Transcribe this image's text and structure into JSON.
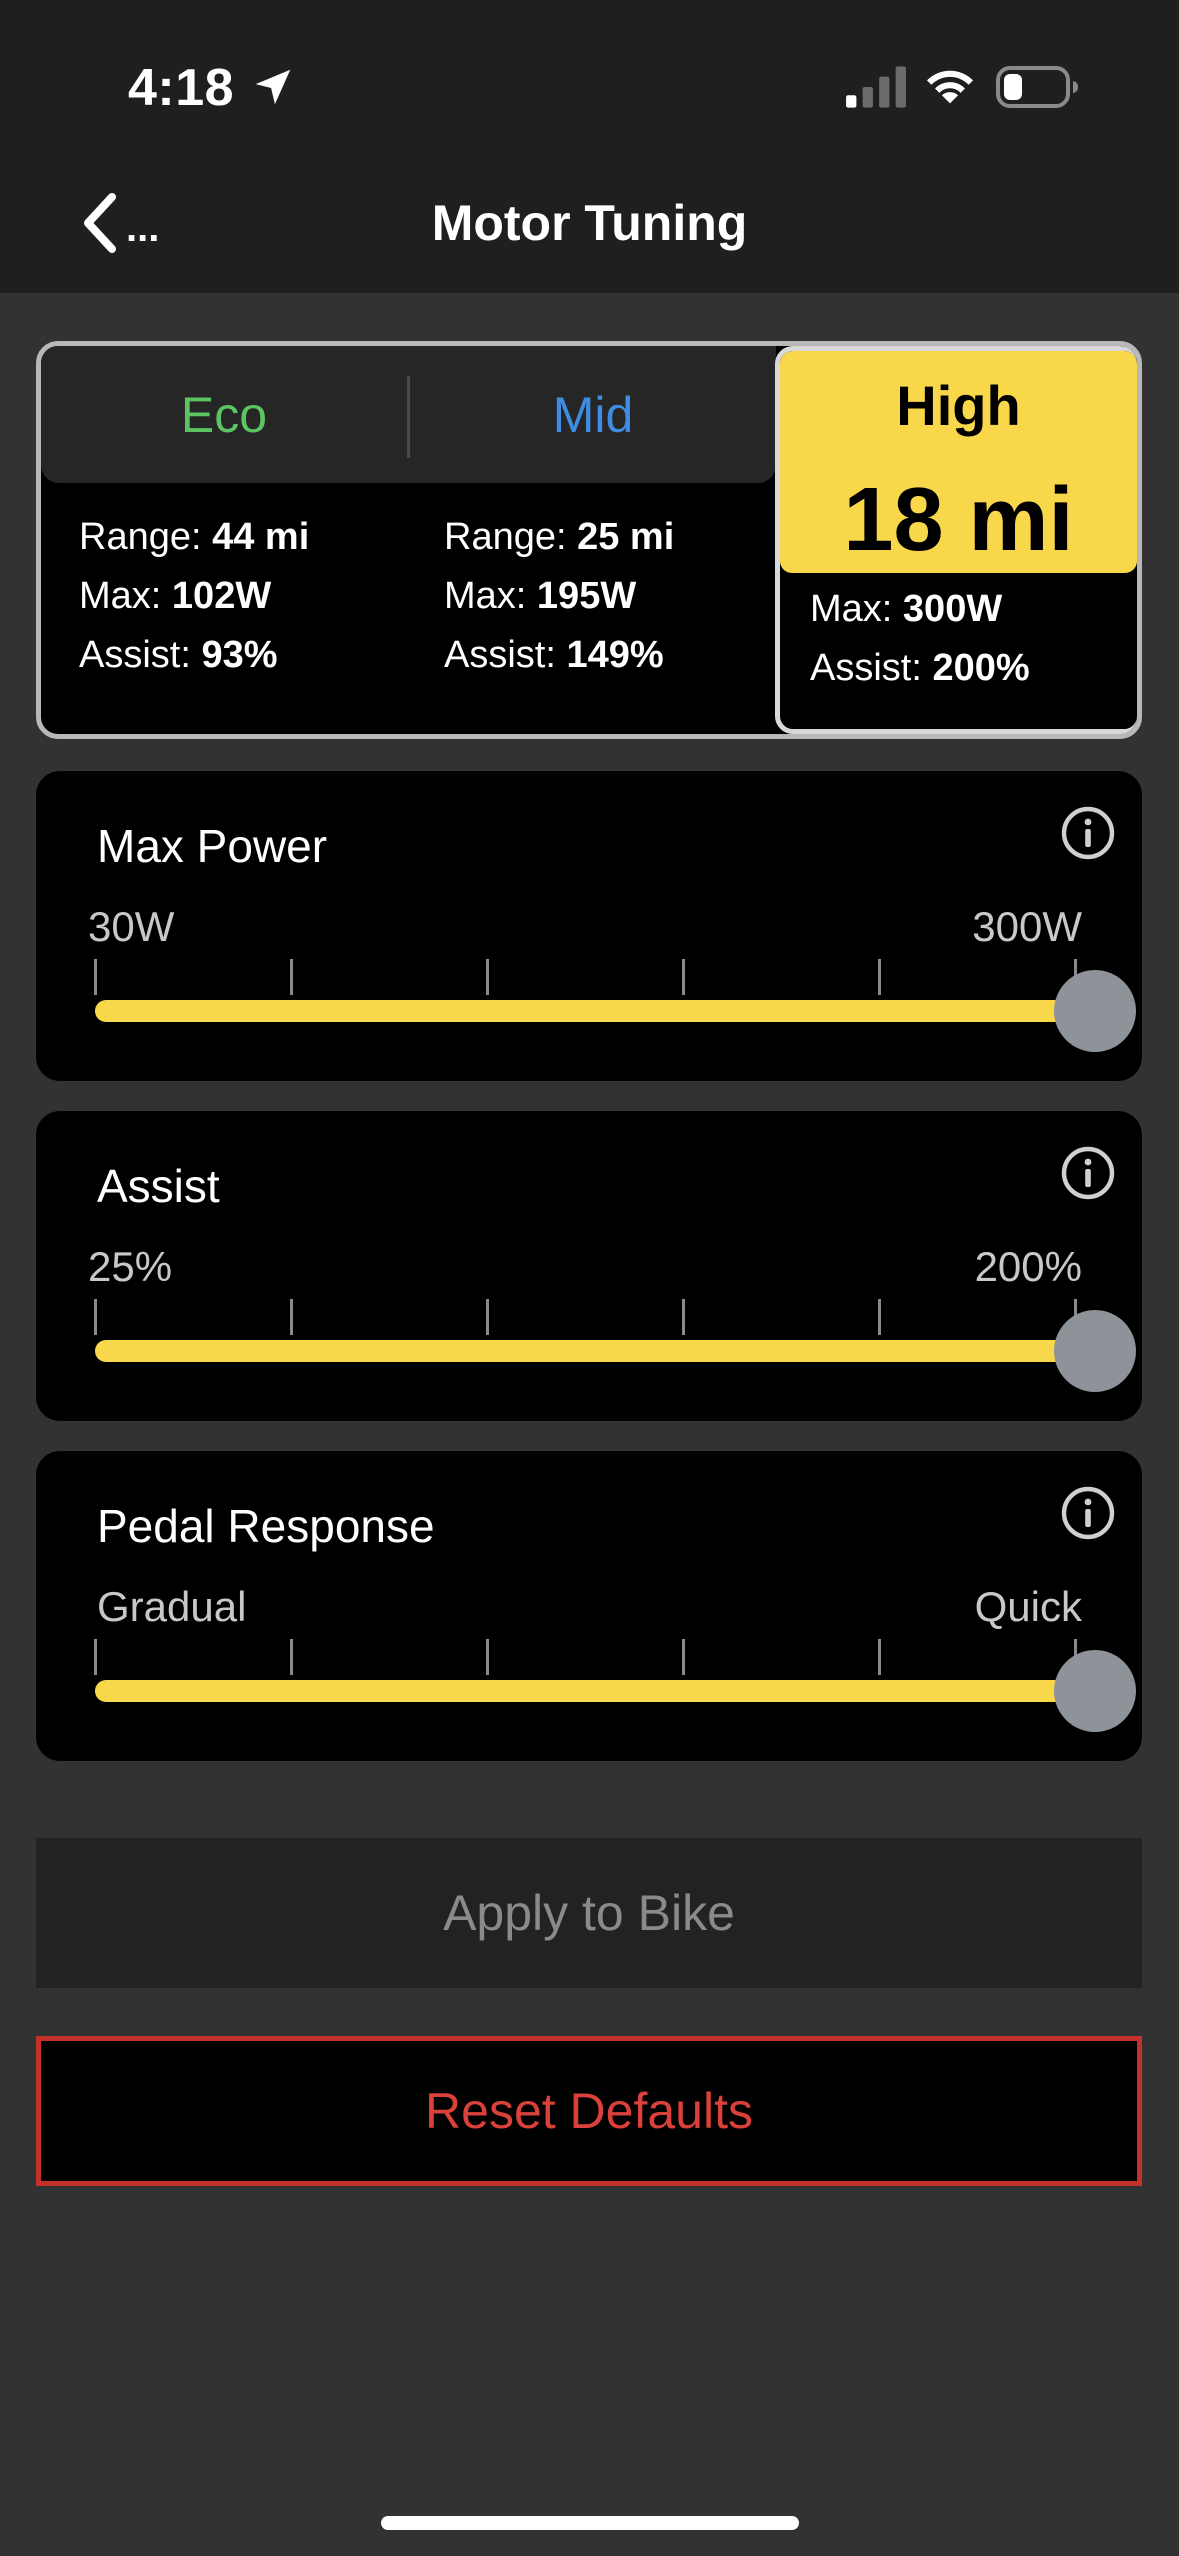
{
  "status_bar": {
    "time": "4:18",
    "icons": [
      "location-arrow-icon",
      "cellular-signal-icon",
      "wifi-icon",
      "battery-icon"
    ]
  },
  "nav": {
    "back_label": "...",
    "title": "Motor Tuning"
  },
  "modes": {
    "eco": {
      "label": "Eco",
      "color": "#5cc461",
      "range_label": "Range:",
      "range_value": "44 mi",
      "max_label": "Max:",
      "max_value": "102W",
      "assist_label": "Assist:",
      "assist_value": "93%"
    },
    "mid": {
      "label": "Mid",
      "color": "#3f8de0",
      "range_label": "Range:",
      "range_value": "25 mi",
      "max_label": "Max:",
      "max_value": "195W",
      "assist_label": "Assist:",
      "assist_value": "149%"
    },
    "high": {
      "label": "High",
      "selected": true,
      "range_value": "18 mi",
      "max_label": "Max:",
      "max_value": "300W",
      "assist_label": "Assist:",
      "assist_value": "200%"
    }
  },
  "sliders": {
    "max_power": {
      "title": "Max Power",
      "min_label": "30W",
      "max_label": "300W",
      "level": 1.0
    },
    "assist": {
      "title": "Assist",
      "min_label": "25%",
      "max_label": "200%",
      "level": 1.0
    },
    "pedal_response": {
      "title": "Pedal Response",
      "min_label": "Gradual",
      "max_label": "Quick",
      "level": 1.0
    }
  },
  "buttons": {
    "apply": "Apply to Bike",
    "reset": "Reset Defaults"
  },
  "colors": {
    "accent_yellow": "#f8d74a",
    "reset_red": "#d9413a"
  }
}
